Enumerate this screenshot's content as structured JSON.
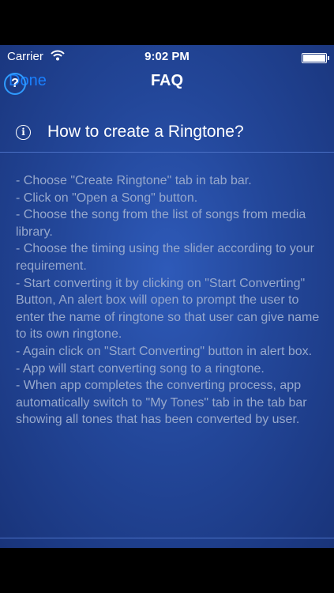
{
  "status": {
    "carrier": "Carrier",
    "time": "9:02 PM"
  },
  "nav": {
    "done": "Done",
    "title": "FAQ"
  },
  "faq": {
    "question": "How to create a Ringtone?",
    "answer": [
      "- Choose \"Create Ringtone\" tab in tab bar.",
      "- Click on \"Open a Song\" button.",
      "- Choose the song from the list of songs from media library.",
      "- Choose the timing using the slider according to your requirement.",
      "- Start converting it by clicking on \"Start Converting\" Button, An alert box will open to prompt the user to enter the name of ringtone so that user can give name to its own ringtone.",
      "- Again click on \"Start Converting\" button in alert box.",
      "- App will start converting song to a ringtone.",
      "- When app completes the converting process, app automatically switch to \"My Tones\" tab in the tab bar showing all tones that has been converted by user."
    ]
  },
  "icons": {
    "help": "question-circle-icon",
    "info": "info-circle-icon",
    "wifi": "wifi-icon",
    "battery": "battery-icon"
  },
  "colors": {
    "accent": "#1a80ff",
    "background": "#23479a",
    "answer_text": "#97a8cc"
  }
}
